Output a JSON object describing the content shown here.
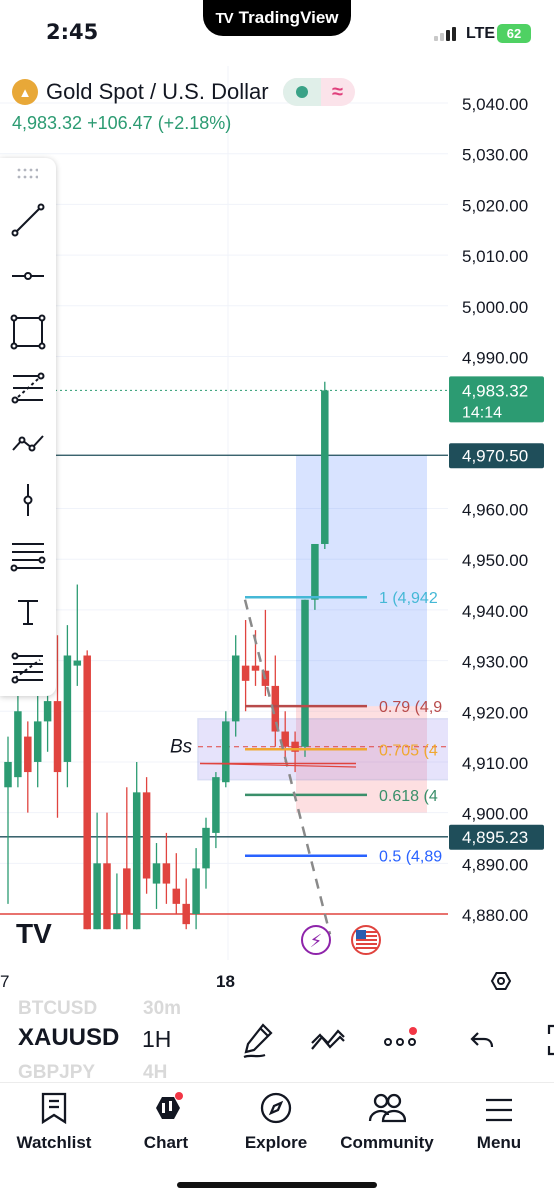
{
  "status_bar": {
    "time": "2:45",
    "app_pill": "TradingView",
    "network": "LTE",
    "battery": "62"
  },
  "header": {
    "symbol_name": "Gold Spot / U.S. Dollar",
    "last_price": "4,983.32",
    "change": "+106.47",
    "change_pct": "(+2.18%)",
    "colors": {
      "up": "#2c9b72",
      "down": "#e0443f",
      "accent": "#2962ff"
    }
  },
  "toolbar": {
    "tools": [
      "trend-line-icon",
      "horizontal-ray-icon",
      "rectangle-icon",
      "fib-retracement-icon",
      "path-icon",
      "vertical-line-icon",
      "parallel-lines-icon",
      "text-icon",
      "pitchfork-icon"
    ]
  },
  "chart_data": {
    "type": "candlestick",
    "price_axis": [
      "5,040.00",
      "5,030.00",
      "5,020.00",
      "5,010.00",
      "5,000.00",
      "4,990.00",
      "4,960.00",
      "4,950.00",
      "4,940.00",
      "4,930.00",
      "4,920.00",
      "4,910.00",
      "4,900.00",
      "4,890.00",
      "4,880.00"
    ],
    "ylim": [
      4877,
      5044
    ],
    "time_axis": [
      "7",
      "18"
    ],
    "last_price_label": {
      "price": "4,983.32",
      "countdown": "14:14"
    },
    "level_labels": [
      {
        "name": "position-entry",
        "value": "4,970.50",
        "price": 4970.5
      },
      {
        "name": "support-level",
        "value": "4,895.23",
        "price": 4895.23
      }
    ],
    "fib_labels": [
      {
        "level": "1 (4,942",
        "price": 4942.5,
        "color": "#45b8d6"
      },
      {
        "level": "0.79 (4,9",
        "price": 4921,
        "color": "#b84a4a"
      },
      {
        "level": "0.705 (4",
        "price": 4912.5,
        "color": "#f0a830"
      },
      {
        "level": "0.618 (4",
        "price": 4903.5,
        "color": "#3a8f6a"
      },
      {
        "level": "0.5 (4,89",
        "price": 4891.5,
        "color": "#2962ff"
      }
    ],
    "annotation": "Bs",
    "red_horizontal_line": 4880,
    "candles": [
      {
        "o": 4905,
        "h": 4915,
        "l": 4882,
        "c": 4910,
        "d": "up"
      },
      {
        "o": 4907,
        "h": 4925,
        "l": 4905,
        "c": 4920,
        "d": "up"
      },
      {
        "o": 4915,
        "h": 4918,
        "l": 4900,
        "c": 4908,
        "d": "down"
      },
      {
        "o": 4910,
        "h": 4927,
        "l": 4905,
        "c": 4918,
        "d": "up"
      },
      {
        "o": 4918,
        "h": 4930,
        "l": 4912,
        "c": 4922,
        "d": "up"
      },
      {
        "o": 4922,
        "h": 4935,
        "l": 4899,
        "c": 4908,
        "d": "down"
      },
      {
        "o": 4910,
        "h": 4937,
        "l": 4905,
        "c": 4931,
        "d": "up"
      },
      {
        "o": 4929,
        "h": 4945,
        "l": 4925,
        "c": 4930,
        "d": "up"
      },
      {
        "o": 4931,
        "h": 4932,
        "l": 4877,
        "c": 4877,
        "d": "down"
      },
      {
        "o": 4877,
        "h": 4900,
        "l": 4877,
        "c": 4890,
        "d": "up"
      },
      {
        "o": 4890,
        "h": 4900,
        "l": 4877,
        "c": 4877,
        "d": "down"
      },
      {
        "o": 4877,
        "h": 4888,
        "l": 4877,
        "c": 4880,
        "d": "up"
      },
      {
        "o": 4880,
        "h": 4905,
        "l": 4877,
        "c": 4889,
        "d": "down"
      },
      {
        "o": 4877,
        "h": 4910,
        "l": 4877,
        "c": 4904,
        "d": "up"
      },
      {
        "o": 4904,
        "h": 4907,
        "l": 4884,
        "c": 4887,
        "d": "down"
      },
      {
        "o": 4886,
        "h": 4894,
        "l": 4881,
        "c": 4890,
        "d": "up"
      },
      {
        "o": 4890,
        "h": 4896,
        "l": 4882,
        "c": 4886,
        "d": "down"
      },
      {
        "o": 4885,
        "h": 4892,
        "l": 4880,
        "c": 4882,
        "d": "down"
      },
      {
        "o": 4882,
        "h": 4887,
        "l": 4877,
        "c": 4878,
        "d": "down"
      },
      {
        "o": 4880,
        "h": 4893,
        "l": 4877,
        "c": 4889,
        "d": "up"
      },
      {
        "o": 4889,
        "h": 4899,
        "l": 4885,
        "c": 4897,
        "d": "up"
      },
      {
        "o": 4896,
        "h": 4908,
        "l": 4893,
        "c": 4907,
        "d": "up"
      },
      {
        "o": 4906,
        "h": 4920,
        "l": 4905,
        "c": 4918,
        "d": "up"
      },
      {
        "o": 4918,
        "h": 4935,
        "l": 4915,
        "c": 4931,
        "d": "up"
      },
      {
        "o": 4929,
        "h": 4938,
        "l": 4920,
        "c": 4926,
        "d": "down"
      },
      {
        "o": 4928,
        "h": 4936,
        "l": 4925,
        "c": 4929,
        "d": "down"
      },
      {
        "o": 4928,
        "h": 4940,
        "l": 4923,
        "c": 4925,
        "d": "down"
      },
      {
        "o": 4925,
        "h": 4931,
        "l": 4913,
        "c": 4916,
        "d": "down"
      },
      {
        "o": 4916,
        "h": 4920,
        "l": 4910,
        "c": 4913,
        "d": "down"
      },
      {
        "o": 4914,
        "h": 4916,
        "l": 4908,
        "c": 4912,
        "d": "down"
      },
      {
        "o": 4913,
        "h": 4942,
        "l": 4911,
        "c": 4942,
        "d": "up"
      },
      {
        "o": 4942,
        "h": 4952,
        "l": 4940,
        "c": 4953,
        "d": "up"
      },
      {
        "o": 4953,
        "h": 4985,
        "l": 4952,
        "c": 4983.3,
        "d": "up"
      }
    ]
  },
  "symbol_bar": {
    "ghost_above": [
      "BTCUSD",
      "30m"
    ],
    "symbol": "XAUUSD",
    "interval": "1H",
    "ghost_below": [
      "GBPJPY",
      "4H"
    ]
  },
  "bottom_nav": {
    "items": [
      {
        "label": "Watchlist",
        "icon": "bookmark-icon"
      },
      {
        "label": "Chart",
        "icon": "candles-icon"
      },
      {
        "label": "Explore",
        "icon": "compass-icon"
      },
      {
        "label": "Community",
        "icon": "people-icon"
      },
      {
        "label": "Menu",
        "icon": "hamburger-icon"
      }
    ]
  }
}
